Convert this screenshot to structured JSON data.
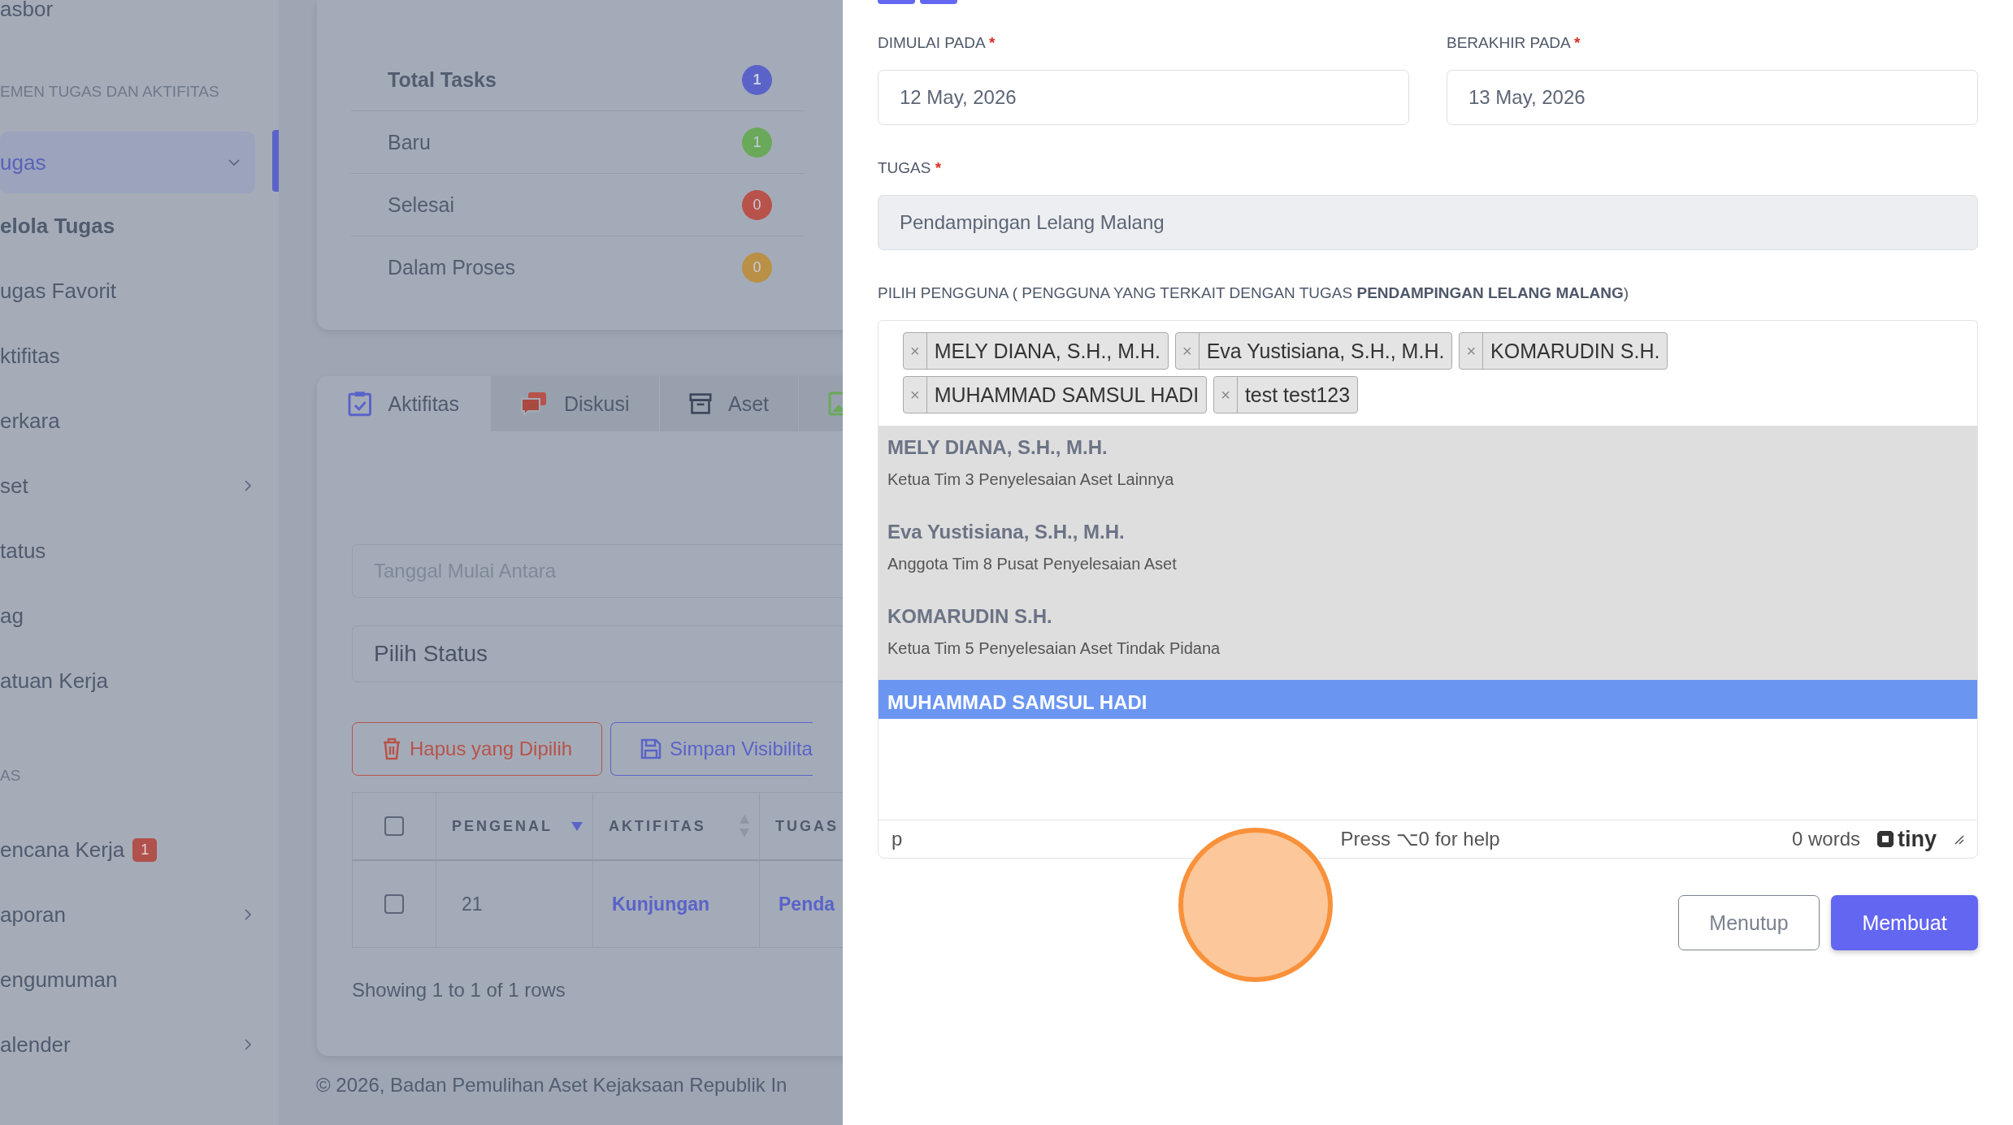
{
  "sidebar": {
    "items": [
      {
        "label": "asbor",
        "kind": "link",
        "selected": false
      },
      {
        "label": "EMEN TUGAS DAN AKTIFITAS",
        "kind": "header"
      },
      {
        "label": "ugas",
        "kind": "group",
        "selected": true,
        "expanded": true,
        "children": [
          {
            "label": "elola Tugas",
            "selected": true
          },
          {
            "label": "ugas Favorit",
            "selected": false
          },
          {
            "label": "ktifitas",
            "selected": false
          }
        ]
      },
      {
        "label": "erkara",
        "kind": "link",
        "selected": false
      },
      {
        "label": "set",
        "kind": "group",
        "selected": false,
        "expanded": false
      },
      {
        "label": "tatus",
        "kind": "link",
        "selected": false
      },
      {
        "label": "ag",
        "kind": "link",
        "selected": false
      },
      {
        "label": "atuan Kerja",
        "kind": "link",
        "selected": false
      },
      {
        "label": "AS",
        "kind": "header"
      },
      {
        "label": "encana Kerja",
        "kind": "link",
        "selected": false,
        "badge": "1"
      },
      {
        "label": "aporan",
        "kind": "group",
        "selected": false,
        "expanded": false
      },
      {
        "label": "engumuman",
        "kind": "link",
        "selected": false
      },
      {
        "label": "alender",
        "kind": "group",
        "selected": false,
        "expanded": false
      }
    ]
  },
  "stats": [
    {
      "label": "Total Tasks",
      "kind": "total",
      "count": "1",
      "color": "#5b63c9"
    },
    {
      "label": "Baru",
      "kind": "status",
      "count": "1",
      "color": "#6aa85a"
    },
    {
      "label": "Selesai",
      "kind": "status",
      "count": "0",
      "color": "#b7534a"
    },
    {
      "label": "Dalam Proses",
      "kind": "status",
      "count": "0",
      "color": "#b99045"
    }
  ],
  "tabs": [
    {
      "label": "Aktifitas",
      "selected": true
    },
    {
      "label": "Diskusi",
      "selected": false
    },
    {
      "label": "Aset",
      "selected": false
    },
    {
      "selected": false
    }
  ],
  "filters": {
    "date_range": {
      "placeholder": "Tanggal Mulai Antara"
    },
    "status": {
      "value": "Pilih Status"
    }
  },
  "actions": [
    {
      "label": "Hapus yang Dipilih",
      "kind": "danger"
    },
    {
      "label": "Simpan Visibilita",
      "kind": "primary"
    }
  ],
  "table": {
    "columns": [
      {
        "kind": "checkbox",
        "checked": false
      },
      {
        "kind": "text",
        "label": "PENGENAL",
        "sorted": true
      },
      {
        "kind": "text",
        "label": "AKTIFITAS",
        "sorted": false
      },
      {
        "kind": "text",
        "label": "TUGAS"
      }
    ],
    "rows": [
      {
        "cells": [
          {
            "kind": "checkbox",
            "checked": false
          },
          {
            "text": "21",
            "link": false
          },
          {
            "text": "Kunjungan",
            "link": true
          },
          {
            "text": "Penda",
            "link": true
          }
        ]
      }
    ]
  },
  "pagination_info": "Showing 1 to 1 of 1 rows",
  "footer": "© 2026, Badan Pemulihan Aset Kejaksaan Republik In",
  "modal": {
    "start": {
      "label": "DIMULAI PADA",
      "required_mark": "*",
      "value": "12 May, 2026"
    },
    "end": {
      "label": "BERAKHIR PADA",
      "required_mark": "*",
      "value": "13 May, 2026"
    },
    "task": {
      "label": "TUGAS",
      "required_mark": "*",
      "value": "Pendampingan Lelang Malang",
      "disabled": true
    },
    "users_label": "PILIH PENGGUNA ( PENGGUNA YANG TERKAIT DENGAN TUGAS **PENDAMPINGAN LELANG MALANG**)",
    "tags": [
      {
        "label": "MELY DIANA, S.H., M.H.",
        "remove": "×"
      },
      {
        "label": "Eva Yustisiana, S.H., M.H.",
        "remove": "×"
      },
      {
        "label": "KOMARUDIN S.H.",
        "remove": "×"
      },
      {
        "label": "MUHAMMAD SAMSUL HADI",
        "remove": "×"
      },
      {
        "label": "test test123",
        "remove": "×"
      }
    ],
    "options": [
      {
        "name": "MELY DIANA, S.H., M.H.",
        "role": "Ketua Tim 3 Penyelesaian Aset Lainnya",
        "selected": false
      },
      {
        "name": "Eva Yustisiana, S.H., M.H.",
        "role": "Anggota Tim 8 Pusat Penyelesaian Aset",
        "selected": false
      },
      {
        "name": "KOMARUDIN S.H.",
        "role": "Ketua Tim 5 Penyelesaian Aset Tindak Pidana",
        "selected": false
      },
      {
        "name": "MUHAMMAD SAMSUL HADI",
        "selected": true
      }
    ],
    "editor": {
      "path": "p",
      "help": "Press ⌥0 for help",
      "word_count": "0 words",
      "brand": "tiny"
    },
    "buttons": [
      {
        "label": "Menutup",
        "kind": "secondary"
      },
      {
        "label": "Membuat",
        "kind": "primary"
      }
    ]
  }
}
